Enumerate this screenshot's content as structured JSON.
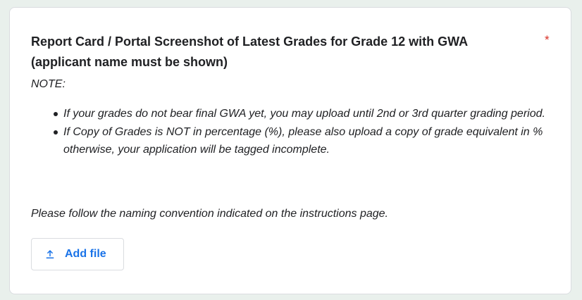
{
  "question": {
    "title": "Report Card / Portal Screenshot of Latest Grades for Grade 12 with GWA (applicant name must be shown)",
    "required_marker": "*",
    "note_label": "NOTE:",
    "note_items": [
      "If your grades do not bear final GWA yet, you may upload until 2nd or 3rd quarter grading period.",
      "If Copy of Grades is NOT in percentage (%), please also upload a copy of grade equivalent in % otherwise, your application will be tagged incomplete."
    ],
    "naming_note": "Please follow the naming convention indicated on the instructions page."
  },
  "upload": {
    "button_label": "Add file",
    "icon": "upload-icon"
  },
  "colors": {
    "accent": "#1a73e8",
    "required": "#d93025",
    "page_background": "#e9f0ec",
    "text": "#202124"
  }
}
